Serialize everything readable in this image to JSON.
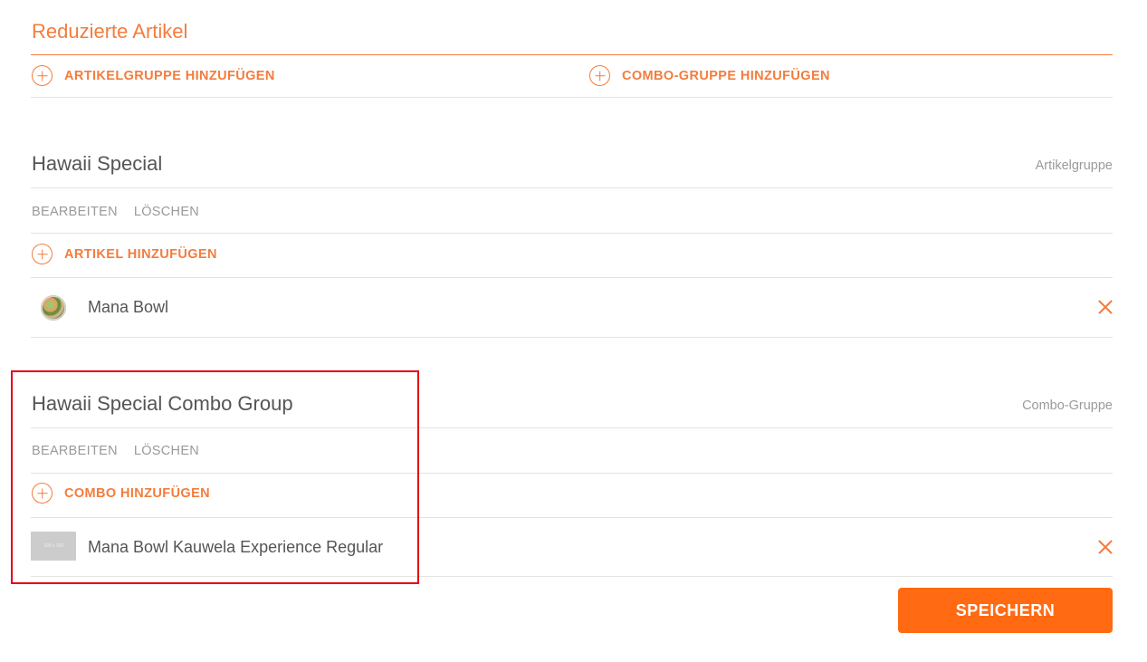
{
  "section": {
    "title": "Reduzierte Artikel",
    "add_article_group_label": "ARTIKELGRUPPE HINZUFÜGEN",
    "add_combo_group_label": "COMBO-GRUPPE HINZUFÜGEN"
  },
  "groups": [
    {
      "title": "Hawaii Special",
      "type": "Artikelgruppe",
      "edit_label": "BEARBEITEN",
      "delete_label": "LÖSCHEN",
      "add_label": "ARTIKEL HINZUFÜGEN",
      "items": [
        {
          "name": "Mana Bowl",
          "thumbnail": "bowl-image"
        }
      ]
    },
    {
      "title": "Hawaii Special Combo Group",
      "type": "Combo-Gruppe",
      "edit_label": "BEARBEITEN",
      "delete_label": "LÖSCHEN",
      "add_label": "COMBO HINZUFÜGEN",
      "items": [
        {
          "name": "Mana Bowl Kauwela Experience Regular",
          "thumbnail": "placeholder-image",
          "thumbnail_text": "100 x 100"
        }
      ]
    }
  ],
  "save_label": "SPEICHERN",
  "colors": {
    "accent": "#f47c3c",
    "button": "#ff6a13",
    "highlight": "#e60012"
  },
  "icons": {
    "add": "plus-circle-icon",
    "remove": "close-icon"
  }
}
